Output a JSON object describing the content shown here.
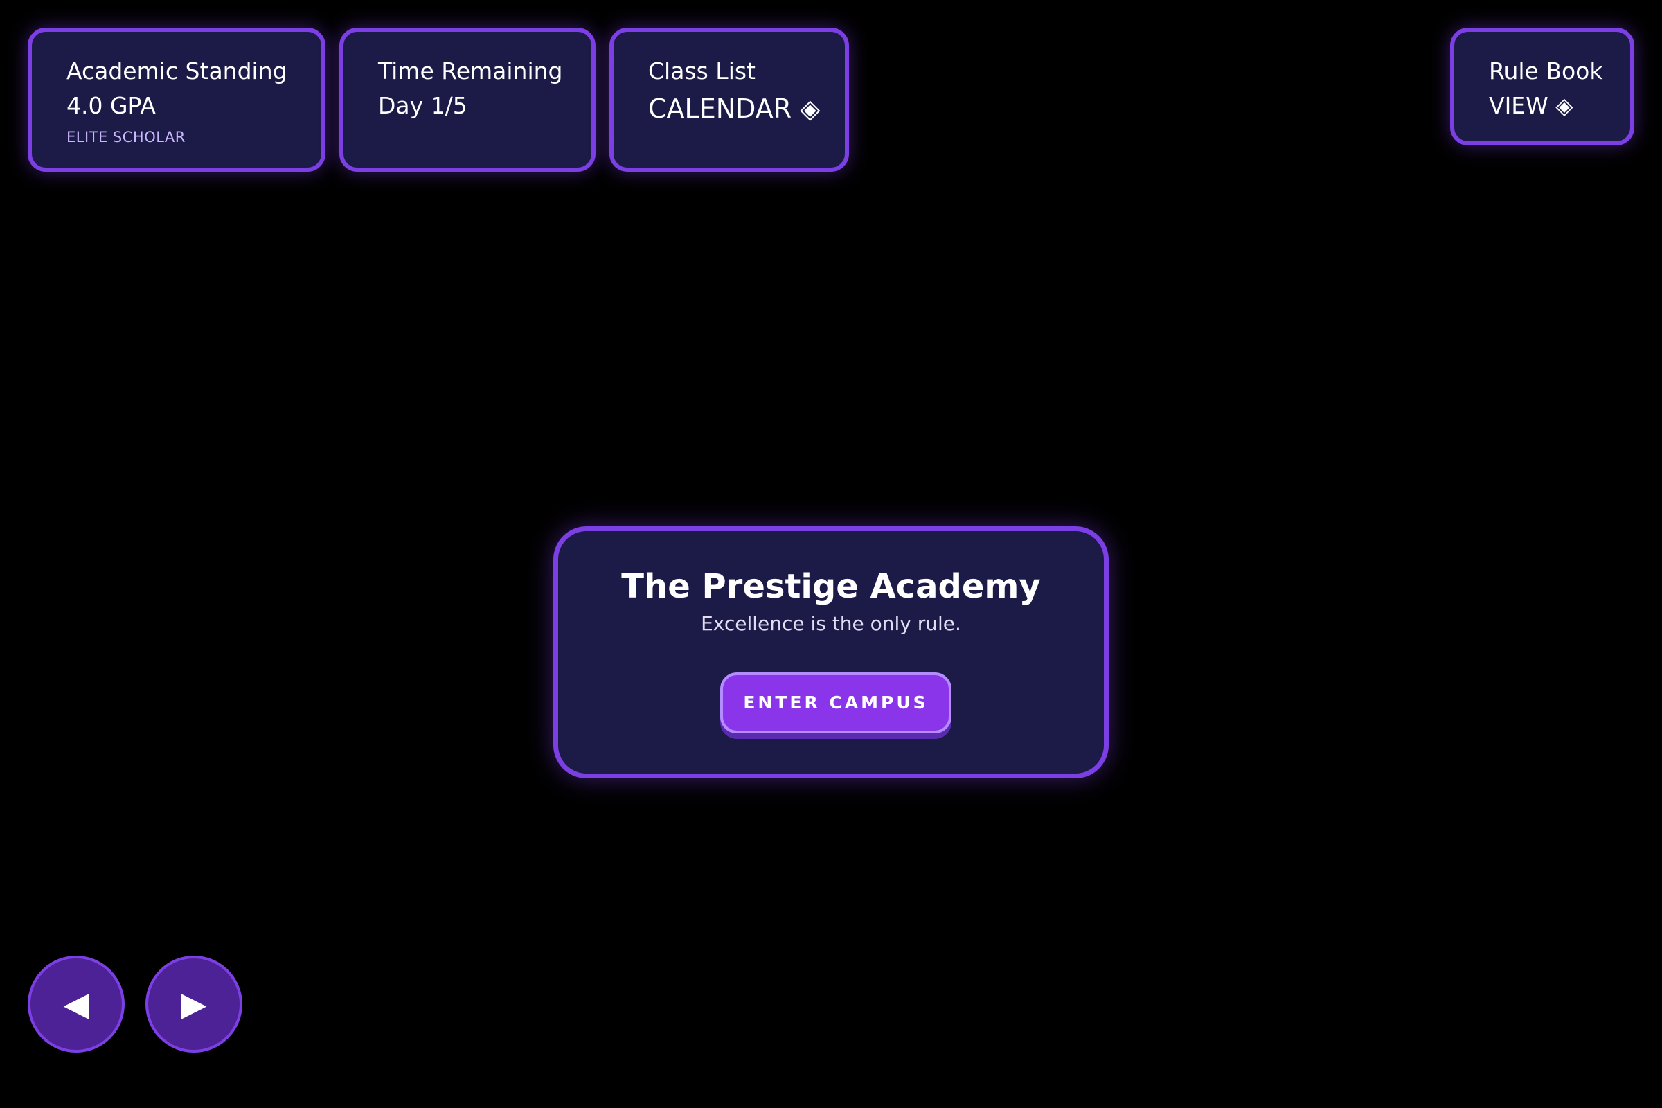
{
  "hud": {
    "standing": {
      "title": "Academic Standing",
      "value": "4.0 GPA",
      "sub": "ELITE SCHOLAR"
    },
    "time": {
      "title": "Time Remaining",
      "value": "Day 1/5"
    },
    "class_list": {
      "title": "Class List",
      "value": "CALENDAR ◈"
    },
    "rule_book": {
      "title": "Rule Book",
      "value": "VIEW ◈"
    }
  },
  "title_screen": {
    "title": "The Prestige Academy",
    "tagline": "Excellence is the only rule.",
    "enter_label": "ENTER CAMPUS"
  },
  "nav": {
    "prev_icon": "◀",
    "next_icon": "▶",
    "prev_icon_name": "left-triangle-icon",
    "next_icon_name": "right-triangle-icon"
  },
  "colors": {
    "background": "#000000",
    "panel": "#1c1a46",
    "accent": "#7b3fe4",
    "button": "#8b35ea"
  }
}
